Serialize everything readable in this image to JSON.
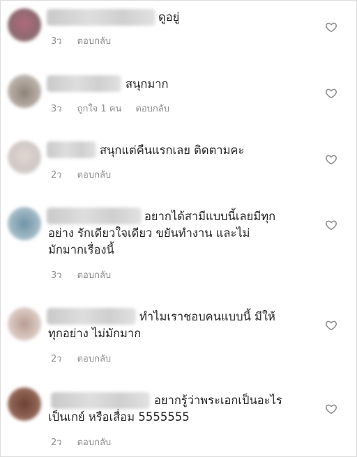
{
  "comments": [
    {
      "lines": [
        "ดูอยู่"
      ],
      "time": "3ว",
      "likes": "",
      "reply": "ตอบกลับ",
      "avatar_color": "#a7707c"
    },
    {
      "lines": [
        "สนุกมาก"
      ],
      "time": "3ว",
      "likes": "ถูกใจ 1 คน",
      "reply": "ตอบกลับ",
      "avatar_color": "#9a8f86"
    },
    {
      "lines": [
        "สนุกแต่คืนแรกเลย ติดตามคะ"
      ],
      "time": "2ว",
      "likes": "",
      "reply": "ตอบกลับ",
      "avatar_color": "#d9d2cf"
    },
    {
      "lines": [
        "อยากได้สามีแบบนี้เลยมีทุก",
        "อย่าง รักเดียวใจเดียว ขยันทำงาน และไม่",
        "มักมากเรื่องนี้"
      ],
      "time": "3ว",
      "likes": "",
      "reply": "ตอบกลับ",
      "avatar_color": "#7fa0b1"
    },
    {
      "lines": [
        "ทำไมเราชอบคนแบบนี้ มีให้",
        "ทุกอย่าง ไม่มักมาก"
      ],
      "time": "2ว",
      "likes": "",
      "reply": "ตอบกลับ",
      "avatar_color": "#c2a89e"
    },
    {
      "lines": [
        "อยากรู้ว่าพระเอกเป็นอะไร",
        "เป็นเกย์ หรือเสื่อม 5555555"
      ],
      "time": "2ว",
      "likes": "",
      "reply": "ตอบกลับ",
      "avatar_color": "#7a4f40"
    }
  ],
  "icons": {
    "like": "heart-outline-icon"
  },
  "colors": {
    "text": "#262626",
    "meta": "#8e8e8e"
  }
}
